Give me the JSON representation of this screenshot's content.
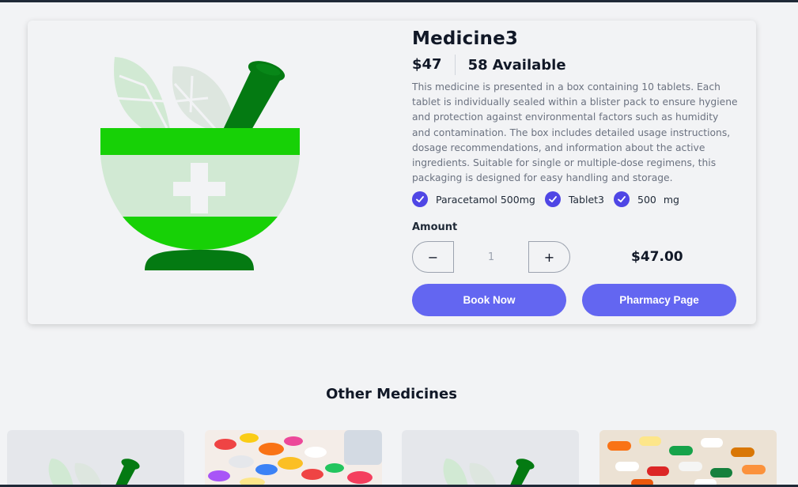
{
  "product": {
    "title": "Medicine3",
    "price": "$47",
    "available_count": "58",
    "available_label": "Available",
    "description": "This medicine is presented in a box containing 10 tablets. Each tablet is individually sealed within a blister pack to ensure hygiene and protection against environmental factors such as humidity and contamination. The box includes detailed usage instructions, dosage recommendations, and information about the active ingredients. Suitable for single or multiple-dose regimens, this packaging is designed for easy handling and storage.",
    "tags": [
      {
        "label": "Paracetamol 500mg"
      },
      {
        "label": "Tablet3"
      },
      {
        "label": "500",
        "unit": "mg"
      }
    ],
    "amount_label": "Amount",
    "quantity": "1",
    "minus_label": "−",
    "plus_label": "+",
    "total": "$47.00",
    "book_now_label": "Book Now",
    "pharmacy_label": "Pharmacy Page"
  },
  "other": {
    "title": "Other Medicines",
    "items": [
      {
        "image": "mortar-pestle-icon"
      },
      {
        "image": "colorful-pills-photo"
      },
      {
        "image": "mortar-pestle-icon"
      },
      {
        "image": "capsules-photo"
      }
    ]
  },
  "colors": {
    "accent": "#6366f1",
    "check": "#4f46e5",
    "leaf_green": "#17d106",
    "dark_green": "#047a12",
    "pale_green": "#d1e9d3"
  }
}
